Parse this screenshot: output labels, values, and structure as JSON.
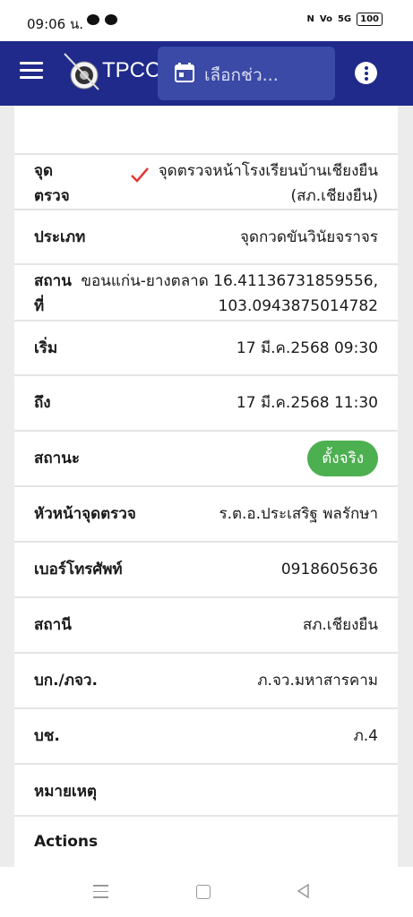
{
  "status": {
    "time": "09:06 น.",
    "battery": "100"
  },
  "appbar": {
    "title": "TPCC",
    "date_placeholder": "เลือกช่ว..."
  },
  "rows": [
    {
      "label": "จุด\nตรวจ",
      "value": "จุดตรวจหน้าโรงเรียนบ้านเชียงยืน\n(สภ.เชียงยืน)"
    },
    {
      "label": "ประเภท",
      "value": "จุดกวดขันวินัยจราจร"
    },
    {
      "label": "สถาน\nที่",
      "value": "ขอนแก่น-ยางตลาด 16.41136731859556,\n103.0943875014782"
    },
    {
      "label": "เริ่ม",
      "value": "17 มี.ค.2568 09:30"
    },
    {
      "label": "ถึง",
      "value": "17 มี.ค.2568 11:30"
    },
    {
      "label": "สถานะ",
      "value": "ตั้งจริง"
    },
    {
      "label": "หัวหน้าจุดตรวจ",
      "value": "ร.ต.อ.ประเสริฐ พลรักษา"
    },
    {
      "label": "เบอร์โทรศัพท์",
      "value": "0918605636"
    },
    {
      "label": "สถานี",
      "value": "สภ.เชียงยืน"
    },
    {
      "label": "บก./ภจว.",
      "value": "ภ.จว.มหาสารคาม"
    },
    {
      "label": "บช.",
      "value": "ภ.4"
    },
    {
      "label": "หมายเหตุ",
      "value": ""
    },
    {
      "label": "Actions",
      "value": ""
    }
  ],
  "colors": {
    "appbar": "#1f2a8a",
    "status_badge": "#4caf50",
    "check": "#e53935"
  }
}
